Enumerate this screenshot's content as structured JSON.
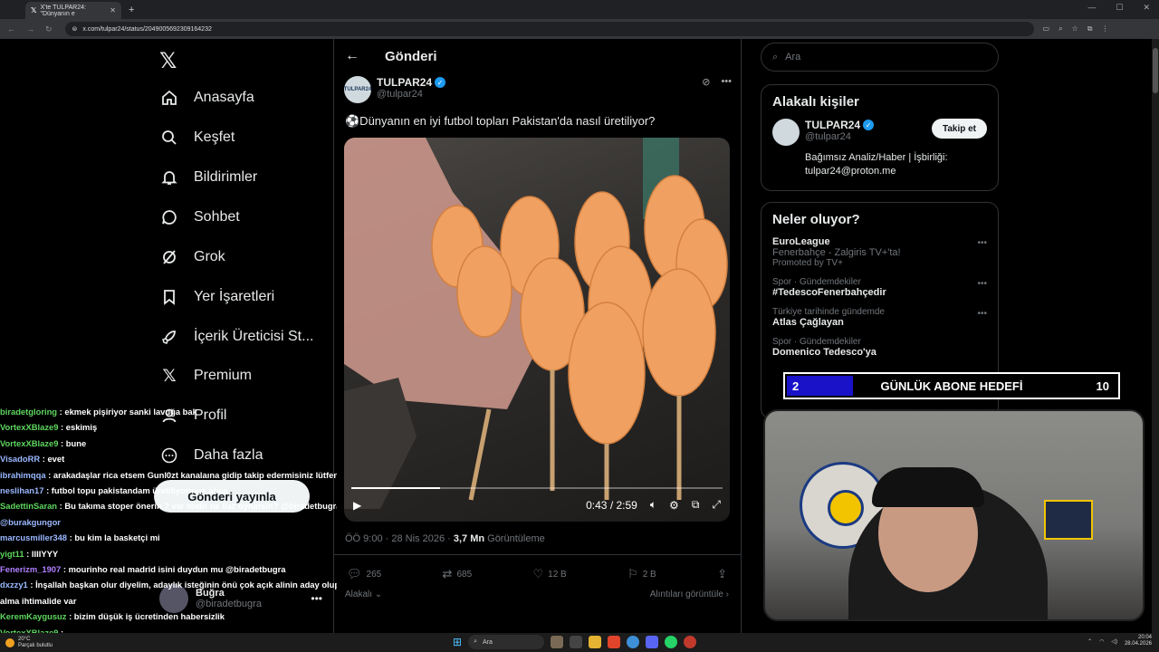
{
  "browser": {
    "tab_title": "X'te TULPAR24: \"Dünyanın e",
    "url": "x.com/tulpar24/status/2049005692309164232"
  },
  "nav": {
    "items": [
      {
        "label": "Anasayfa",
        "icon": "home-icon"
      },
      {
        "label": "Keşfet",
        "icon": "search-icon"
      },
      {
        "label": "Bildirimler",
        "icon": "bell-icon"
      },
      {
        "label": "Sohbet",
        "icon": "chat-icon"
      },
      {
        "label": "Grok",
        "icon": "grok-icon"
      },
      {
        "label": "Yer İşaretleri",
        "icon": "bookmark-icon"
      },
      {
        "label": "İçerik Üreticisi St...",
        "icon": "rocket-icon"
      },
      {
        "label": "Premium",
        "icon": "x-icon"
      },
      {
        "label": "Profil",
        "icon": "person-icon"
      },
      {
        "label": "Daha fazla",
        "icon": "more-circle-icon"
      }
    ],
    "post_button": "Gönderi yayınla",
    "account_name": "Buğra",
    "account_handle": "@biradetbugra"
  },
  "post": {
    "header": "Gönderi",
    "author_name": "TULPAR24",
    "author_handle": "@tulpar24",
    "avatar_text": "TULPAR24",
    "text": "⚽Dünyanın en iyi futbol topları Pakistan'da nasıl üretiliyor?",
    "video_time": "0:43 / 2:59",
    "video_progress": 0.24,
    "time": "ÖÖ 9:00 · 28 Nis 2026 · ",
    "views_count": "3,7 Mn",
    "views_label": " Görüntüleme",
    "replies": "265",
    "reposts": "685",
    "likes": "12 B",
    "bookmarks": "2 B",
    "sort_left": "Alakalı",
    "sort_right": "Alıntıları görüntüle"
  },
  "right": {
    "search_placeholder": "Ara",
    "related_title": "Alakalı kişiler",
    "related_name": "TULPAR24",
    "related_handle": "@tulpar24",
    "follow_label": "Takip et",
    "bio_line1": "Bağımsız Analiz/Haber | İşbirliği:",
    "bio_line2": "tulpar24@proton.me",
    "trends_title": "Neler oluyor?",
    "trends": [
      {
        "context": "",
        "title": "EuroLeague",
        "sub": "Fenerbahçe - Zalgiris TV+'ta!",
        "promo": "Promoted by TV+"
      },
      {
        "context": "Spor · Gündemdekiler",
        "title": "#TedescoFenerbahçedir",
        "sub": "",
        "promo": ""
      },
      {
        "context": "Türkiye tarihinde gündemde",
        "title": "Atlas Çağlayan",
        "sub": "",
        "promo": ""
      },
      {
        "context": "Spor · Gündemdekiler",
        "title": "Domenico Tedesco'ya",
        "sub": "",
        "promo": ""
      }
    ]
  },
  "goal": {
    "current": "2",
    "label": "GÜNLÜK ABONE HEDEFİ",
    "target": "10",
    "progress": 0.2
  },
  "chat": [
    {
      "user": "biradetgloring",
      "color": "#5ed65e",
      "msg": " : ekmek pişiriyor sanki lavuğa bak"
    },
    {
      "user": "VortexXBlaze9",
      "color": "#5ed65e",
      "msg": " : eskimiş"
    },
    {
      "user": "VortexXBlaze9",
      "color": "#5ed65e",
      "msg": " : bune"
    },
    {
      "user": "VisadoRR",
      "color": "#9ab8ff",
      "msg": " : evet"
    },
    {
      "user": "ibrahimqqa",
      "color": "#9ab8ff",
      "msg": " : arakadaşlar rica etsem Gunl0zt kanalaına gidip takip edermisiniz lütfen"
    },
    {
      "user": "neslihan17",
      "color": "#9ab8ff",
      "msg": " : futbol topu pakistandam üretiliyormuş abaa"
    },
    {
      "user": "SadettinSaran",
      "color": "#5ed65e",
      "msg": " : Bu takıma stoper önerin ? var mıdır ne ilaz oynatsin? @biradetbugra"
    },
    {
      "user": "",
      "color": "#9ab8ff",
      "msg": "@burakgungor"
    },
    {
      "user": "marcusmiller348",
      "color": "#9ab8ff",
      "msg": " : bu kim la basketçi mi"
    },
    {
      "user": "yigt11",
      "color": "#5ed65e",
      "msg": " : IIIIYYY"
    },
    {
      "user": "Fenerizm_1907",
      "color": "#b07fff",
      "msg": " : mourinho real madrid isini duydun mu @biradetbugra"
    },
    {
      "user": "dxzzy1",
      "color": "#9ab8ff",
      "msg": " : İnşallah başkan olur diyelim, adaylık isteğinin önü çok açık alinin aday olup"
    },
    {
      "user": "",
      "color": "#fff",
      "msg": "alma ihtimalide var"
    },
    {
      "user": "KeremKaygusuz",
      "color": "#5ed65e",
      "msg": " : bizim düşük iş ücretinden habersizlik"
    },
    {
      "user": "VortexXBlaze9",
      "color": "#5ed65e",
      "msg": " : "
    }
  ],
  "taskbar": {
    "weather_temp": "20°C",
    "weather_desc": "Parçalı bulutlu",
    "search": "Ara",
    "time": "20:04",
    "date": "28.04.2026"
  }
}
